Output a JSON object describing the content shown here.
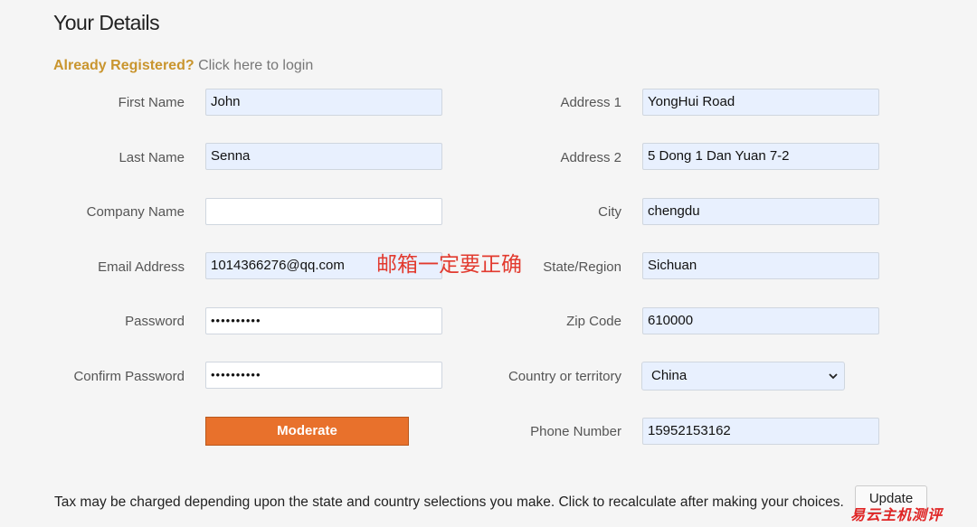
{
  "page": {
    "title": "Your Details"
  },
  "login": {
    "already": "Already Registered?",
    "click": "Click here to login"
  },
  "left_fields": [
    {
      "label": "First Name",
      "value": "John"
    },
    {
      "label": "Last Name",
      "value": "Senna"
    },
    {
      "label": "Company Name",
      "value": ""
    },
    {
      "label": "Email Address",
      "value": "1014366276@qq.com"
    },
    {
      "label": "Password",
      "value": "••••••••••"
    },
    {
      "label": "Confirm Password",
      "value": "••••••••••"
    }
  ],
  "right_fields": [
    {
      "label": "Address 1",
      "value": "YongHui Road"
    },
    {
      "label": "Address 2",
      "value": "5 Dong 1 Dan Yuan 7-2"
    },
    {
      "label": "City",
      "value": "chengdu"
    },
    {
      "label": "State/Region",
      "value": "Sichuan"
    },
    {
      "label": "Zip Code",
      "value": "610000"
    },
    {
      "label": "Country or territory",
      "value": "China"
    },
    {
      "label": "Phone Number",
      "value": "15952153162"
    }
  ],
  "annotation": "邮箱一定要正确",
  "buttons": {
    "moderate": "Moderate",
    "update": "Update"
  },
  "tax_note": "Tax may be charged depending upon the state and country selections you make. Click to recalculate after making your choices.",
  "watermark": "易云主机测评",
  "colors": {
    "accent_orange": "#e8712c",
    "registered_gold": "#c9952e",
    "annotation_red": "#e23a2e",
    "input_fill": "#e8f0fe"
  }
}
